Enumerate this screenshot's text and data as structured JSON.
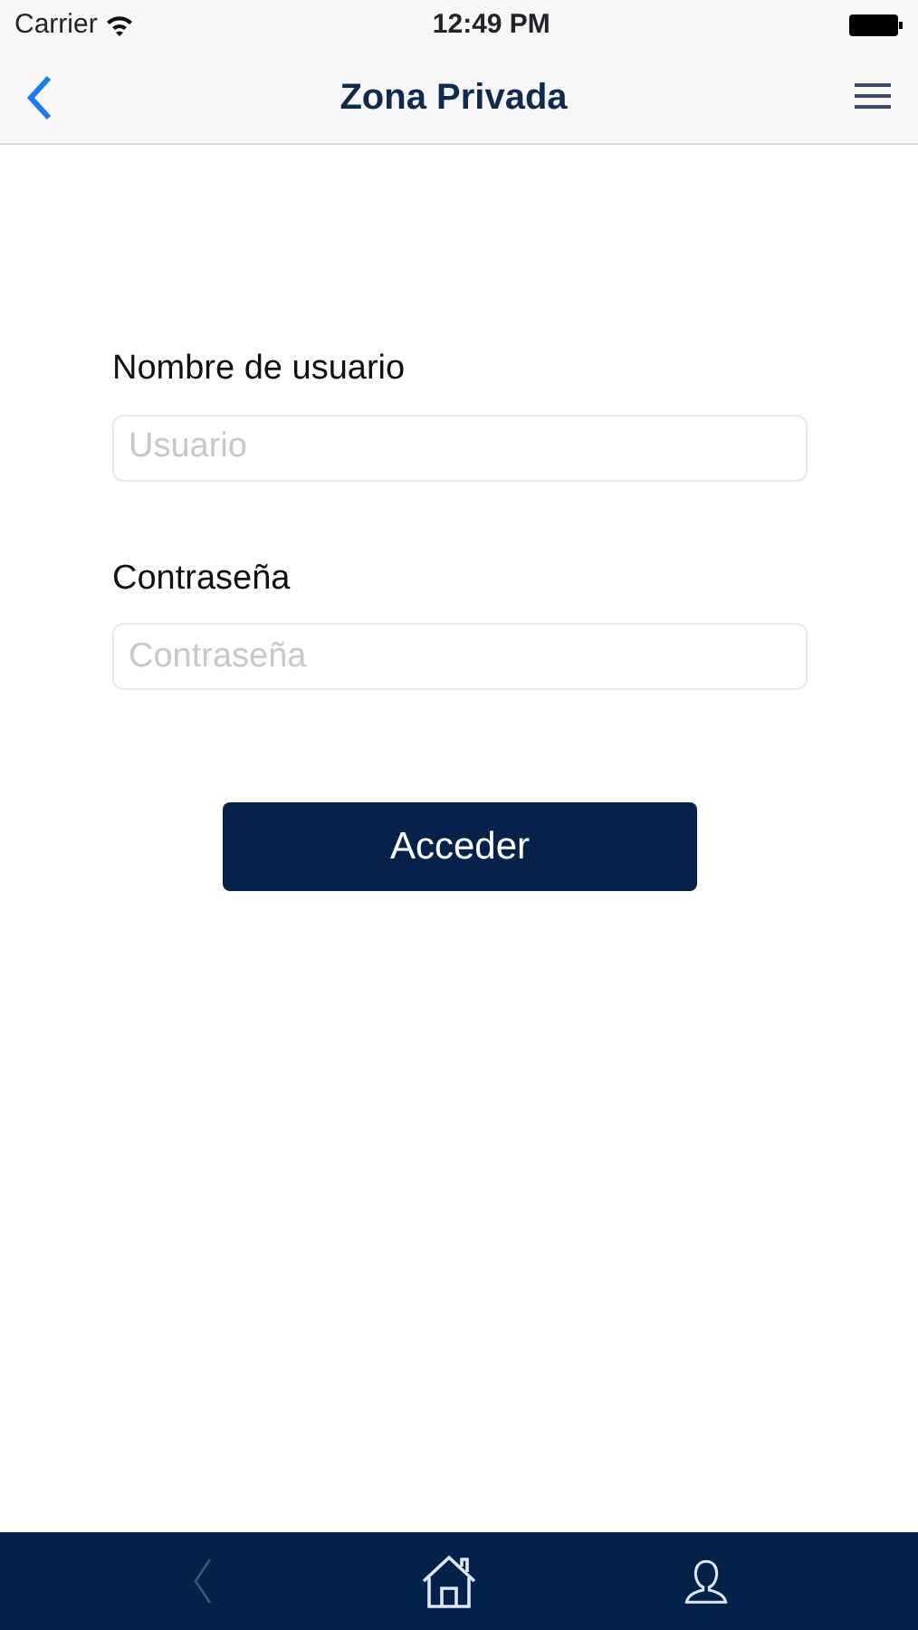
{
  "status_bar": {
    "carrier": "Carrier",
    "time": "12:49 PM"
  },
  "nav_bar": {
    "title": "Zona Privada"
  },
  "form": {
    "fields": [
      {
        "label": "Nombre de usuario",
        "placeholder": "Usuario"
      },
      {
        "label": "Contraseña",
        "placeholder": "Contraseña"
      }
    ],
    "submit": "Acceder"
  },
  "bottom_bar": [
    {
      "kind": "back",
      "disabled": true
    },
    {
      "kind": "home",
      "disabled": false
    },
    {
      "kind": "profile",
      "disabled": false
    }
  ]
}
